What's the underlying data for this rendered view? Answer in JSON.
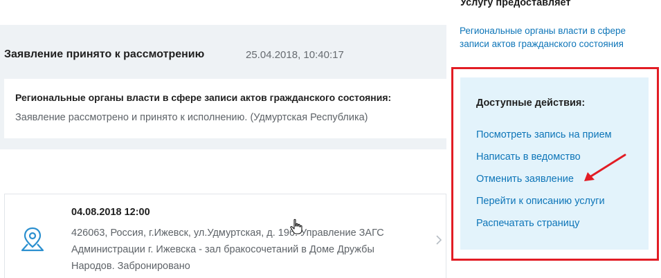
{
  "status": {
    "title": "Заявление принято к рассмотрению",
    "timestamp": "25.04.2018, 10:40:17",
    "organization": "Региональные органы власти в сфере записи актов гражданского состояния:",
    "message": "Заявление рассмотрено и принято к исполнению. (Удмуртская Республика)"
  },
  "appointment": {
    "date": "04.08.2018 12:00",
    "address": "426063, Россия, г.Ижевск, ул.Удмуртская, д. 196. Управление ЗАГС Администрации г. Ижевска - зал бракосочетаний в Доме Дружбы Народов. Забронировано",
    "icon": "map-pin-icon"
  },
  "sidebar": {
    "provider_heading": "Услугу предоставляет",
    "provider_link": "Региональные органы власти в сфере записи актов гражданского состояния",
    "actions_heading": "Доступные действия:",
    "actions": [
      {
        "label": "Посмотреть запись на прием"
      },
      {
        "label": "Написать в ведомство"
      },
      {
        "label": "Отменить заявление"
      },
      {
        "label": "Перейти к описанию услуги"
      },
      {
        "label": "Распечатать страницу"
      }
    ]
  },
  "colors": {
    "link": "#0d75b8",
    "actions_panel_bg": "#e3f3fb",
    "card_bg": "#eef2f5",
    "highlight": "#e21c24"
  }
}
